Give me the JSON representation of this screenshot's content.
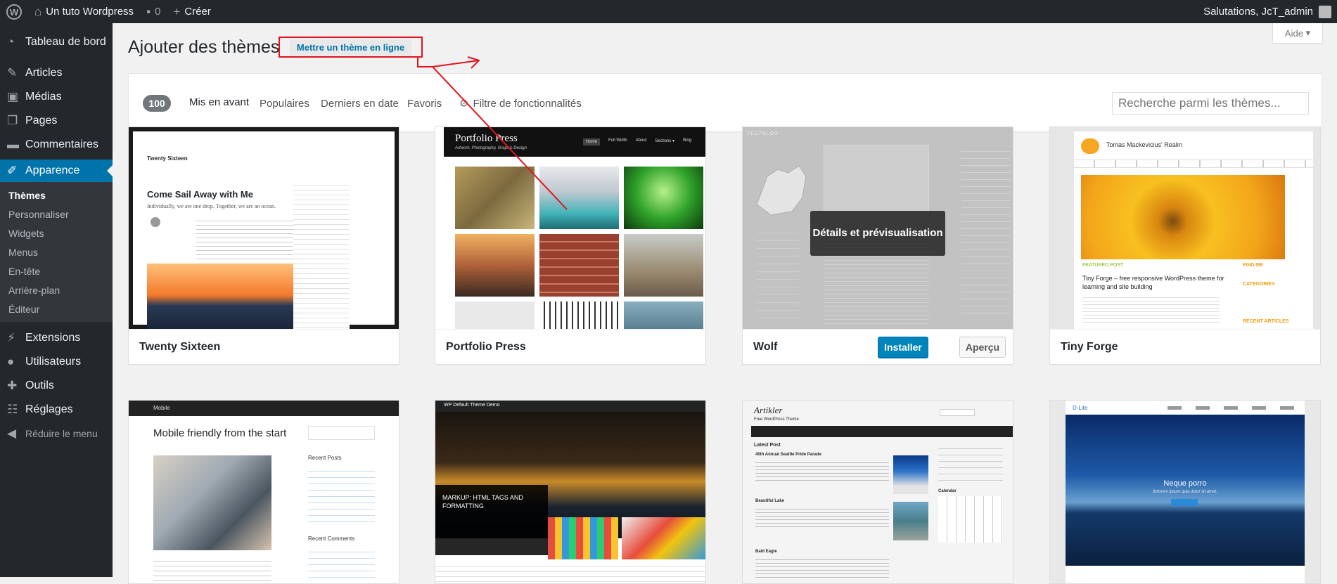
{
  "adminbar": {
    "site_name": "Un tuto Wordpress",
    "comments_count": "0",
    "new_label": "Créer",
    "greeting": "Salutations, JcT_admin"
  },
  "sidebar": {
    "items": [
      {
        "label": "Tableau de bord",
        "icon": "dashboard-icon"
      },
      {
        "label": "Articles",
        "icon": "pin-icon"
      },
      {
        "label": "Médias",
        "icon": "media-icon"
      },
      {
        "label": "Pages",
        "icon": "pages-icon"
      },
      {
        "label": "Commentaires",
        "icon": "comments-icon"
      },
      {
        "label": "Apparence",
        "icon": "appearance-icon"
      },
      {
        "label": "Extensions",
        "icon": "plugins-icon"
      },
      {
        "label": "Utilisateurs",
        "icon": "users-icon"
      },
      {
        "label": "Outils",
        "icon": "tools-icon"
      },
      {
        "label": "Réglages",
        "icon": "settings-icon"
      }
    ],
    "submenu": [
      "Thèmes",
      "Personnaliser",
      "Widgets",
      "Menus",
      "En-tête",
      "Arrière-plan",
      "Éditeur"
    ],
    "collapse_label": "Réduire le menu"
  },
  "header": {
    "help_label": "Aide",
    "title": "Ajouter des thèmes",
    "upload_label": "Mettre un thème en ligne"
  },
  "filter": {
    "count": "100",
    "tabs": [
      "Mis en avant",
      "Populaires",
      "Derniers en date",
      "Favoris"
    ],
    "feature_filter_label": "Filtre de fonctionnalités",
    "search_placeholder": "Recherche parmi les thèmes..."
  },
  "themes": [
    {
      "name": "Twenty Sixteen"
    },
    {
      "name": "Portfolio Press"
    },
    {
      "name": "Wolf",
      "details_label": "Détails et prévisualisation",
      "install_label": "Installer",
      "preview_label": "Aperçu"
    },
    {
      "name": "Tiny Forge"
    }
  ],
  "shots": {
    "twentysixteen": {
      "site_title": "Twenty Sixteen",
      "post_title": "Come Sail Away with Me",
      "tagline": "Individually, we are one drop. Together, we are an ocean."
    },
    "portfolio": {
      "site_title": "Portfolio Press",
      "tagline": "Artwork, Photography, Graphic Design",
      "nav": [
        "Home",
        "Full Width",
        "About",
        "Sections ▾",
        "Blog"
      ]
    },
    "wolf": {
      "site_title": "TESTBLOG"
    },
    "tinyforge": {
      "site_title": "Tomas Mackevicius' Realm",
      "featured": "FEATURED POST",
      "post_title": "Tiny Forge – free responsive WordPress theme for learning and site building",
      "find_me": "FIND ME",
      "categories": "CATEGORIES",
      "recent": "RECENT ARTICLES"
    },
    "mobile": {
      "site_title": "Mobile",
      "post_title": "Mobile friendly from the start",
      "recent_posts": "Recent Posts",
      "recent_comments": "Recent Comments"
    },
    "wpdefault": {
      "site_title": "WP Default Theme Demo",
      "post_title": "MARKUP: HTML TAGS AND FORMATTING"
    },
    "artikler": {
      "site_title": "Artikler",
      "subtitle": "Free WordPress Theme",
      "latest": "Latest Post",
      "post1": "40th Annual Seattle Pride Parade",
      "post2": "Beautiful Lake",
      "post3": "Bald Eagle",
      "calendar": "Calendar"
    },
    "dlite": {
      "site_title": "D-Lite",
      "slide_title": "Neque porro",
      "slide_text": "dolorem ipsum quia dolor sit amet,"
    }
  },
  "colors": {
    "adminbar": "#23282d",
    "accent": "#0073aa",
    "highlight": "#e0141e"
  }
}
